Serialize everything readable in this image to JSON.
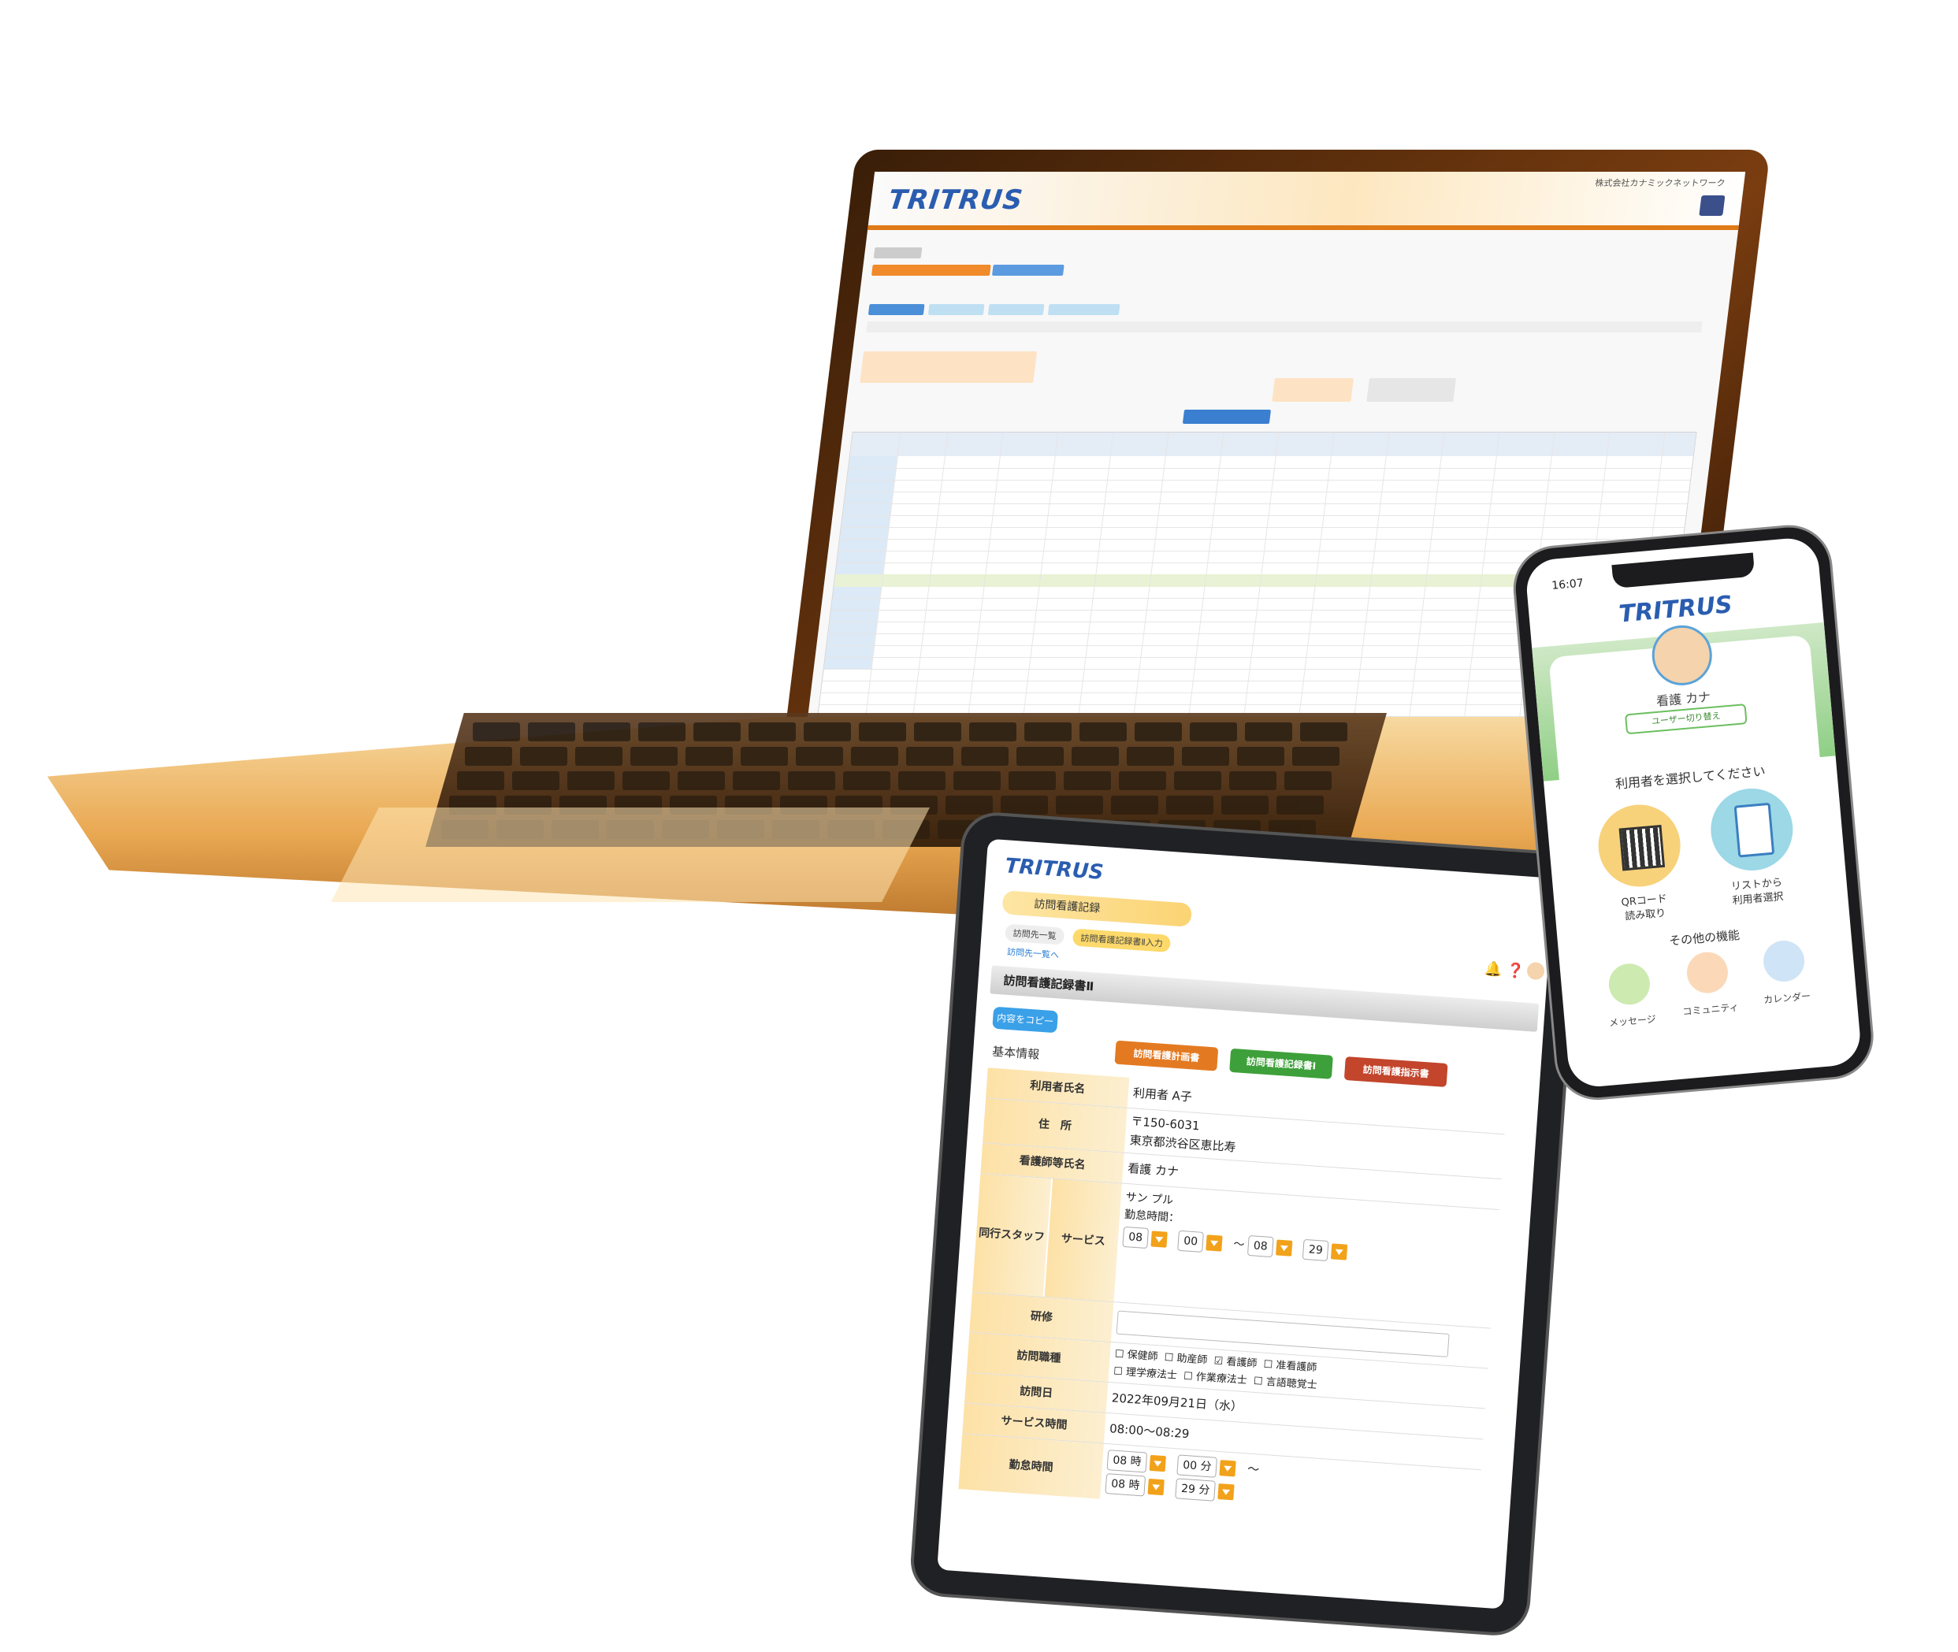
{
  "laptop": {
    "logo": "TRITRUS",
    "company": "株式会社カナミックネットワーク"
  },
  "tablet": {
    "logo": "TRITRUS",
    "page_title": "訪問看護記録",
    "breadcrumb_1": "訪問先一覧",
    "breadcrumb_2": "訪問看護記録書Ⅱ入力",
    "back_link": "訪問先一覧へ",
    "section_title": "訪問看護記録書Ⅱ",
    "copy_button": "内容をコピー",
    "btn_plan": "訪問看護計画書",
    "btn_record": "訪問看護記録書Ⅰ",
    "btn_instruction": "訪問看護指示書",
    "basic_info": "基本情報",
    "rows": {
      "user_name_label": "利用者氏名",
      "user_name_value": "利用者 A子",
      "address_label": "住　所",
      "postal": "〒150-6031",
      "address": "東京都渋谷区恵比寿",
      "nurse_label": "看護師等氏名",
      "nurse_value": "看護 カナ",
      "staff_label": "同行スタッフ",
      "service_label": "サービス",
      "staff_name": "サン プル",
      "work_time_label": "勤怠時間：",
      "training_label": "研修",
      "job_label": "訪問職種",
      "jobs": [
        "保健師",
        "助産師",
        "看護師",
        "准看護師",
        "理学療法士",
        "作業療法士",
        "言語聴覚士"
      ],
      "visit_date_label": "訪問日",
      "visit_date_value": "2022年09月21日（水）",
      "service_time_label": "サービス時間",
      "service_time_value": "08:00〜08:29",
      "attendance_label": "勤怠時間",
      "hour_1": "08",
      "min_1": "00",
      "hour_2": "08",
      "min_2": "29",
      "hour_unit": "時",
      "min_unit": "分",
      "tilde": "〜"
    }
  },
  "phone": {
    "time": "16:07",
    "logo": "TRITRUS",
    "user_name": "看護 カナ",
    "switch_user": "ユーザー切り替え",
    "prompt": "利用者を選択してください",
    "qr_label_1": "QRコード",
    "qr_label_2": "読み取り",
    "list_label_1": "リストから",
    "list_label_2": "利用者選択",
    "other_title": "その他の機能",
    "message": "メッセージ",
    "community": "コミュニティ",
    "calendar": "カレンダー"
  },
  "colors": {
    "brand_blue": "#2a5db0",
    "accent_orange": "#f2a21a",
    "green": "#6bbf5e"
  }
}
